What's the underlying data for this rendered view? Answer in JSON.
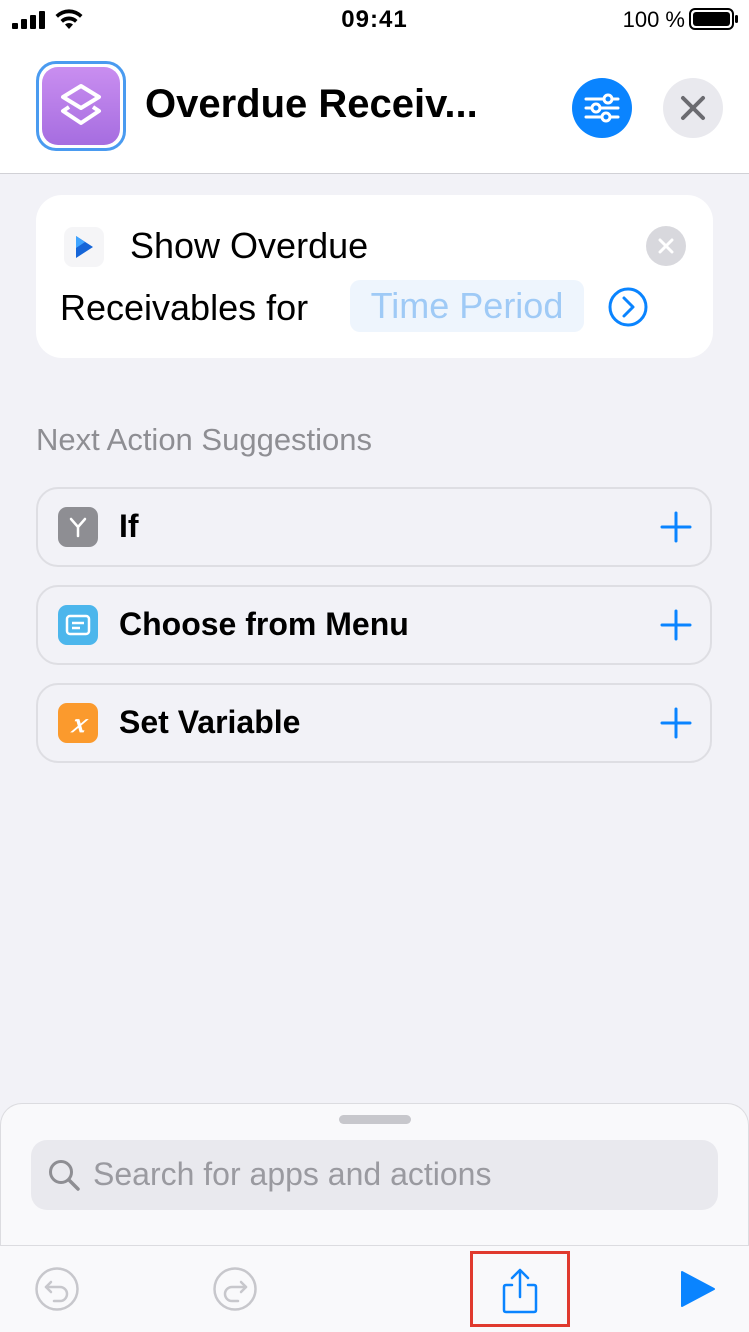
{
  "status_bar": {
    "time": "09:41",
    "battery_percent": "100 %"
  },
  "header": {
    "title": "Overdue Receiv...",
    "app_icon": "shortcuts-icon",
    "settings_icon": "sliders-icon",
    "close_icon": "close-icon"
  },
  "action": {
    "app_icon": "play-arrow-icon",
    "line1": "Show Overdue",
    "line2": "Receivables for",
    "parameter_placeholder": "Time Period"
  },
  "suggestions": {
    "title": "Next Action Suggestions",
    "items": [
      {
        "label": "If",
        "icon": "branch-icon",
        "color": "#8e8e93"
      },
      {
        "label": "Choose from Menu",
        "icon": "menu-icon",
        "color": "#4cb6ec"
      },
      {
        "label": "Set Variable",
        "icon": "variable-icon",
        "color": "#fb9a2d"
      }
    ]
  },
  "search": {
    "placeholder": "Search for apps and actions"
  },
  "toolbar": {
    "undo_icon": "undo-icon",
    "redo_icon": "redo-icon",
    "share_icon": "share-icon",
    "run_icon": "play-icon"
  },
  "colors": {
    "accent": "#0a84ff",
    "highlight": "#e03a2e"
  }
}
